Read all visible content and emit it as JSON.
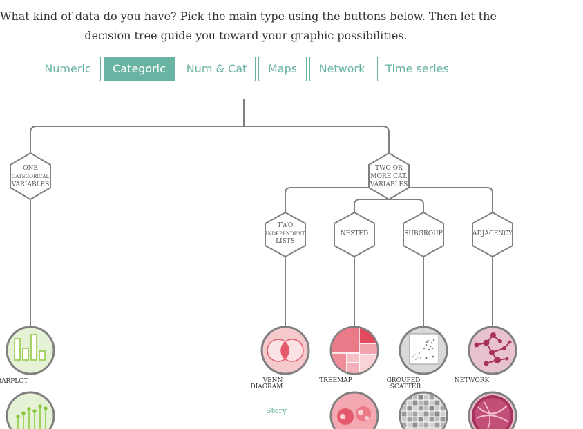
{
  "intro": {
    "line1": "What kind of data do you have? Pick the main type using the buttons below. Then let the",
    "line2": "decision tree guide you toward your graphic possibilities."
  },
  "tabs": [
    {
      "label": "Numeric",
      "active": false
    },
    {
      "label": "Categoric",
      "active": true
    },
    {
      "label": "Num & Cat",
      "active": false
    },
    {
      "label": "Maps",
      "active": false
    },
    {
      "label": "Network",
      "active": false
    },
    {
      "label": "Time series",
      "active": false
    }
  ],
  "tree": {
    "node_one": [
      "ONE",
      "CATEGORICAL",
      "VARIABLES"
    ],
    "node_two": [
      "TWO OR",
      "MORE CAT.",
      "VARIABLES"
    ],
    "node_independent": [
      "TWO",
      "INDEPENDENT",
      "LISTS"
    ],
    "node_nested": [
      "NESTED"
    ],
    "node_subgroup": [
      "SUBGROUP"
    ],
    "node_adjacency": [
      "ADJACENCY"
    ]
  },
  "leaves": {
    "barplot": "BARPLOT",
    "venn": [
      "VENN",
      "DIAGRAM"
    ],
    "treemap": "TREEMAP",
    "grouped_scatter": [
      "GROUPED",
      "SCATTER"
    ],
    "network": "NETWORK",
    "story": "Story"
  },
  "colors": {
    "accent": "#69b3a2",
    "tree_line": "#808080",
    "green_theme": "#8cc63f",
    "red_theme": "#e45a6c",
    "grey_theme": "#999999",
    "maroon_theme": "#a8325e"
  }
}
